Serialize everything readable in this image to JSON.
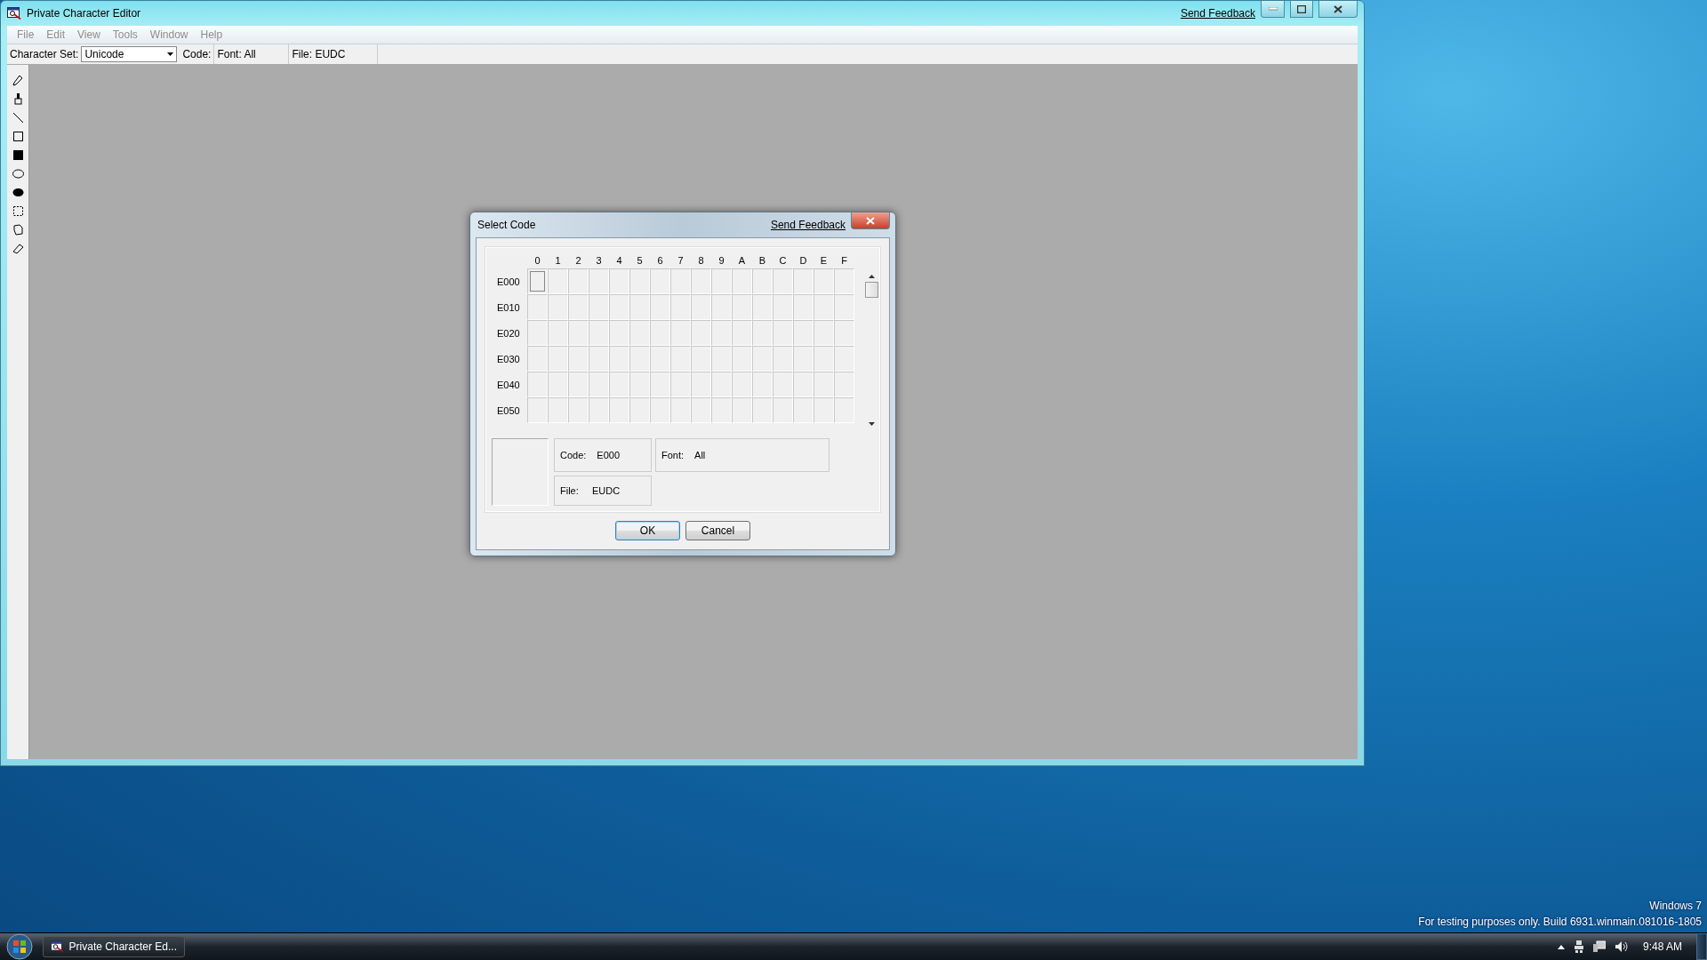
{
  "window": {
    "title": "Private Character Editor",
    "feedback_link": "Send Feedback"
  },
  "menu": [
    {
      "label": "File",
      "disabled": true
    },
    {
      "label": "Edit",
      "disabled": true
    },
    {
      "label": "View",
      "disabled": true
    },
    {
      "label": "Tools",
      "disabled": true
    },
    {
      "label": "Window",
      "disabled": true
    },
    {
      "label": "Help",
      "disabled": true
    }
  ],
  "toolbar": {
    "character_set_label": "Character Set:",
    "character_set": "Unicode",
    "code": "Code:",
    "font": "Font: All",
    "file": "File: EUDC"
  },
  "dialog": {
    "title": "Select Code",
    "feedback_link": "Send Feedback",
    "columns": [
      "0",
      "1",
      "2",
      "3",
      "4",
      "5",
      "6",
      "7",
      "8",
      "9",
      "A",
      "B",
      "C",
      "D",
      "E",
      "F"
    ],
    "rows": [
      {
        "label": "E000",
        "cells": [
          {
            "selected": true
          },
          {
            "selected": false
          },
          {
            "selected": false
          },
          {
            "selected": false
          },
          {
            "selected": false
          },
          {
            "selected": false
          },
          {
            "selected": false
          },
          {
            "selected": false
          },
          {
            "selected": false
          },
          {
            "selected": false
          },
          {
            "selected": false
          },
          {
            "selected": false
          },
          {
            "selected": false
          },
          {
            "selected": false
          },
          {
            "selected": false
          },
          {
            "selected": false
          }
        ]
      },
      {
        "label": "E010",
        "cells": [
          {
            "selected": false
          },
          {
            "selected": false
          },
          {
            "selected": false
          },
          {
            "selected": false
          },
          {
            "selected": false
          },
          {
            "selected": false
          },
          {
            "selected": false
          },
          {
            "selected": false
          },
          {
            "selected": false
          },
          {
            "selected": false
          },
          {
            "selected": false
          },
          {
            "selected": false
          },
          {
            "selected": false
          },
          {
            "selected": false
          },
          {
            "selected": false
          },
          {
            "selected": false
          }
        ]
      },
      {
        "label": "E020",
        "cells": [
          {
            "selected": false
          },
          {
            "selected": false
          },
          {
            "selected": false
          },
          {
            "selected": false
          },
          {
            "selected": false
          },
          {
            "selected": false
          },
          {
            "selected": false
          },
          {
            "selected": false
          },
          {
            "selected": false
          },
          {
            "selected": false
          },
          {
            "selected": false
          },
          {
            "selected": false
          },
          {
            "selected": false
          },
          {
            "selected": false
          },
          {
            "selected": false
          },
          {
            "selected": false
          }
        ]
      },
      {
        "label": "E030",
        "cells": [
          {
            "selected": false
          },
          {
            "selected": false
          },
          {
            "selected": false
          },
          {
            "selected": false
          },
          {
            "selected": false
          },
          {
            "selected": false
          },
          {
            "selected": false
          },
          {
            "selected": false
          },
          {
            "selected": false
          },
          {
            "selected": false
          },
          {
            "selected": false
          },
          {
            "selected": false
          },
          {
            "selected": false
          },
          {
            "selected": false
          },
          {
            "selected": false
          },
          {
            "selected": false
          }
        ]
      },
      {
        "label": "E040",
        "cells": [
          {
            "selected": false
          },
          {
            "selected": false
          },
          {
            "selected": false
          },
          {
            "selected": false
          },
          {
            "selected": false
          },
          {
            "selected": false
          },
          {
            "selected": false
          },
          {
            "selected": false
          },
          {
            "selected": false
          },
          {
            "selected": false
          },
          {
            "selected": false
          },
          {
            "selected": false
          },
          {
            "selected": false
          },
          {
            "selected": false
          },
          {
            "selected": false
          },
          {
            "selected": false
          }
        ]
      },
      {
        "label": "E050",
        "cells": [
          {
            "selected": false
          },
          {
            "selected": false
          },
          {
            "selected": false
          },
          {
            "selected": false
          },
          {
            "selected": false
          },
          {
            "selected": false
          },
          {
            "selected": false
          },
          {
            "selected": false
          },
          {
            "selected": false
          },
          {
            "selected": false
          },
          {
            "selected": false
          },
          {
            "selected": false
          },
          {
            "selected": false
          },
          {
            "selected": false
          },
          {
            "selected": false
          },
          {
            "selected": false
          }
        ]
      }
    ],
    "code_label": "Code:",
    "code": "E000",
    "font_label": "Font:",
    "font": "All",
    "file_label": "File:",
    "file": "EUDC",
    "buttons": [
      {
        "label": "OK",
        "default": true
      },
      {
        "label": "Cancel",
        "default": false
      }
    ]
  },
  "desktop": {
    "edition": "Windows 7",
    "build_notice": "For testing purposes only. Build 6931.winmain.081016-1805"
  },
  "taskbar": {
    "tasks": [
      {
        "label": "Private Character Ed...",
        "selected": false
      }
    ],
    "clock": "9:48 AM"
  }
}
